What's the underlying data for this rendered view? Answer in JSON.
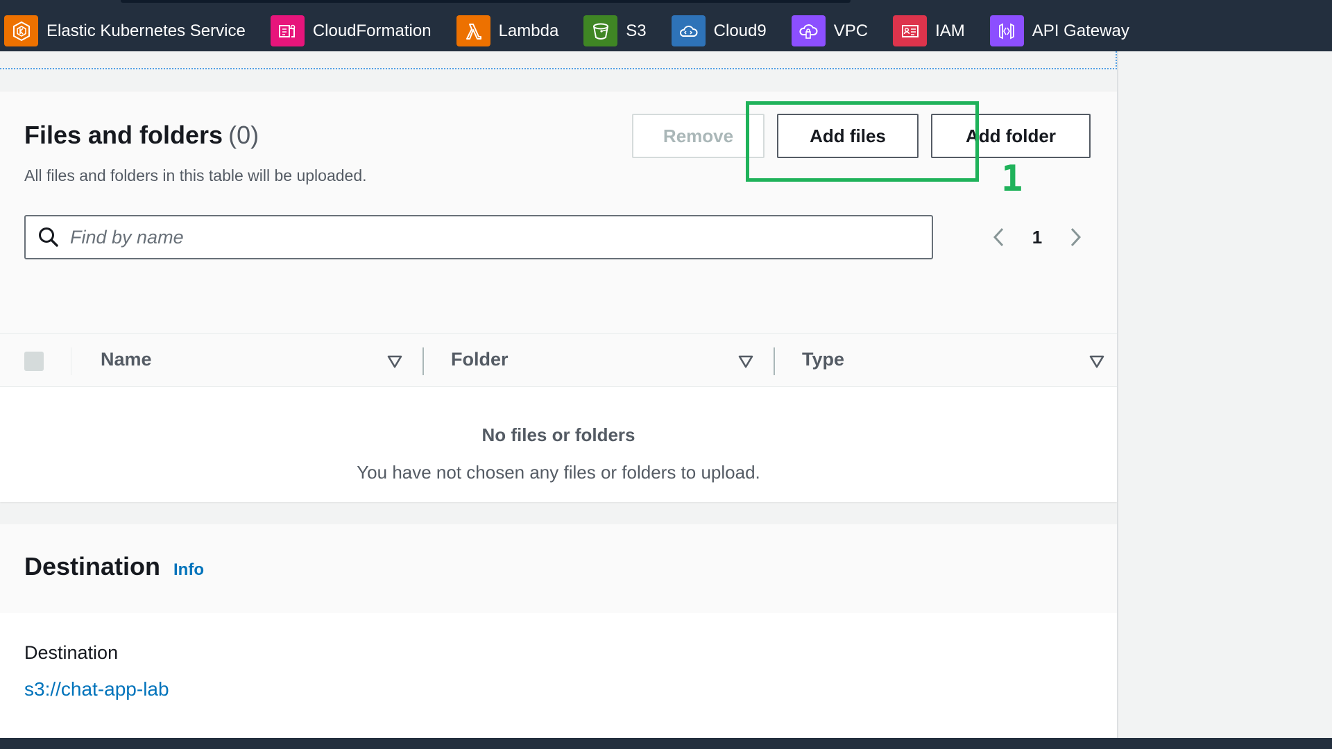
{
  "topbar": {
    "services": [
      {
        "label": "Elastic Kubernetes Service",
        "icon": "eks-icon",
        "color": "#ed7100"
      },
      {
        "label": "CloudFormation",
        "icon": "cloudformation-icon",
        "color": "#e7157b"
      },
      {
        "label": "Lambda",
        "icon": "lambda-icon",
        "color": "#ed7100"
      },
      {
        "label": "S3",
        "icon": "s3-icon",
        "color": "#3f8624"
      },
      {
        "label": "Cloud9",
        "icon": "cloud9-icon",
        "color": "#2e73b8"
      },
      {
        "label": "VPC",
        "icon": "vpc-icon",
        "color": "#8c4fff"
      },
      {
        "label": "IAM",
        "icon": "iam-icon",
        "color": "#dd344c"
      },
      {
        "label": "API Gateway",
        "icon": "api-gateway-icon",
        "color": "#8c4fff"
      }
    ]
  },
  "files": {
    "title": "Files and folders",
    "count": "(0)",
    "description": "All files and folders in this table will be uploaded.",
    "remove_label": "Remove",
    "add_files_label": "Add files",
    "add_folder_label": "Add folder",
    "annotation_number": "1",
    "search_placeholder": "Find by name",
    "page_number": "1",
    "columns": [
      "Name",
      "Folder",
      "Type"
    ],
    "empty_title": "No files or folders",
    "empty_description": "You have not chosen any files or folders to upload."
  },
  "destination": {
    "title": "Destination",
    "info_label": "Info",
    "field_label": "Destination",
    "value": "s3://chat-app-lab"
  },
  "colors": {
    "highlight": "#1fb25a",
    "link": "#0073bb",
    "topbar": "#232f3e"
  }
}
